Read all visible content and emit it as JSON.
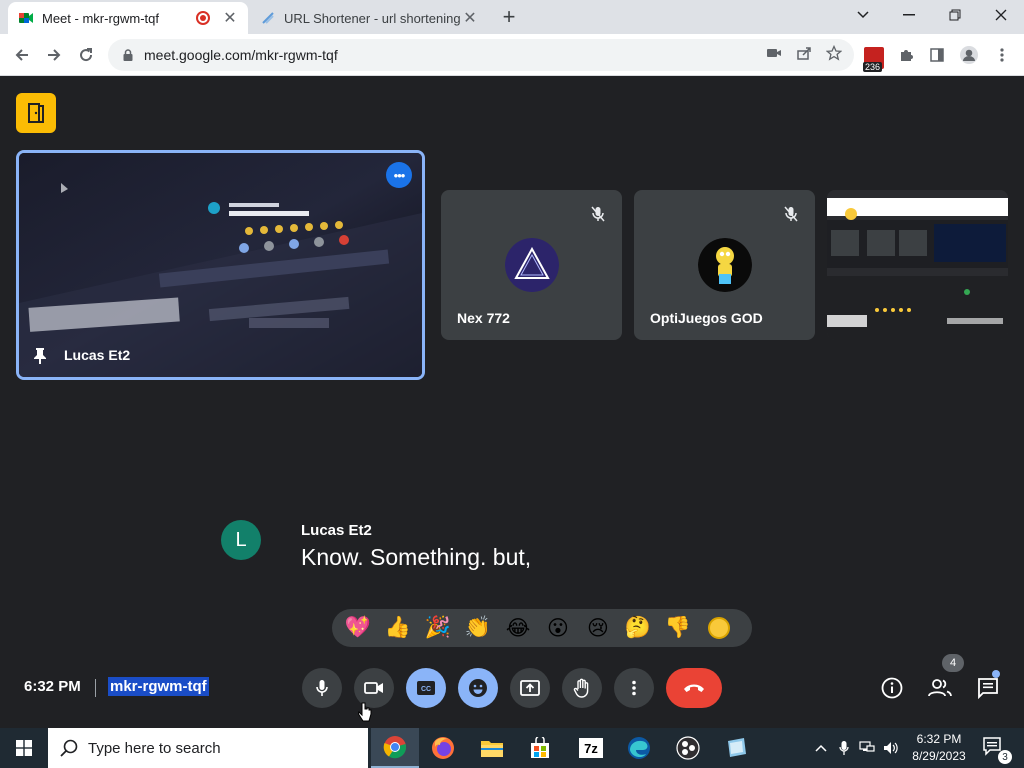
{
  "browser": {
    "tabs": [
      {
        "title": "Meet - mkr-rgwm-tqf",
        "active": true,
        "recording": true
      },
      {
        "title": "URL Shortener - url shortening se",
        "active": false
      }
    ],
    "url": "meet.google.com/mkr-rgwm-tqf",
    "extension_badge": "236"
  },
  "meet": {
    "tiles": [
      {
        "name": "Lucas Et2",
        "pinned": true,
        "type": "screen"
      },
      {
        "name": "Nex 772",
        "muted": true,
        "type": "avatar"
      },
      {
        "name": "OptiJuegos GOD",
        "muted": true,
        "type": "avatar"
      },
      {
        "name": "",
        "type": "screen-preview"
      }
    ],
    "caption": {
      "avatar_letter": "L",
      "speaker": "Lucas Et2",
      "text": "Know. Something. but,"
    },
    "reactions": [
      "💖",
      "👍",
      "🎉",
      "👏",
      "😂",
      "😮",
      "😢",
      "🤔",
      "👎"
    ],
    "time": "6:32 PM",
    "meeting_code": "mkr-rgwm-tqf",
    "people_count": "4",
    "accent_color": "#8ab4f8",
    "end_call_color": "#ea4335"
  },
  "taskbar": {
    "search_placeholder": "Type here to search",
    "clock_time": "6:32 PM",
    "clock_date": "8/29/2023",
    "notifications": "3"
  }
}
